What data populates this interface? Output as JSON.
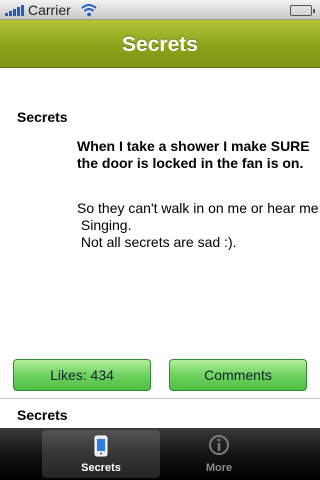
{
  "status_bar": {
    "carrier": "Carrier",
    "icons": [
      "signal-bars-icon",
      "wifi-icon",
      "battery-icon"
    ],
    "battery_level": 1.0
  },
  "nav_bar": {
    "title": "Secrets",
    "color": "#8ca31c"
  },
  "post": {
    "heading": "Secrets",
    "lead": "When I take a shower I make SURE the door is locked in the fan is on.",
    "body": "So they can't walk in on me or hear me...\n Singing.\n Not all secrets are sad :).",
    "likes_label": "Likes: 434",
    "comments_label": "Comments",
    "button_color": "#6fd25f"
  },
  "next_post": {
    "heading": "Secrets"
  },
  "tab_bar": {
    "tabs": [
      {
        "label": "Secrets",
        "icon": "phone-icon",
        "active": true
      },
      {
        "label": "More",
        "icon": "info-icon",
        "active": false
      }
    ]
  }
}
